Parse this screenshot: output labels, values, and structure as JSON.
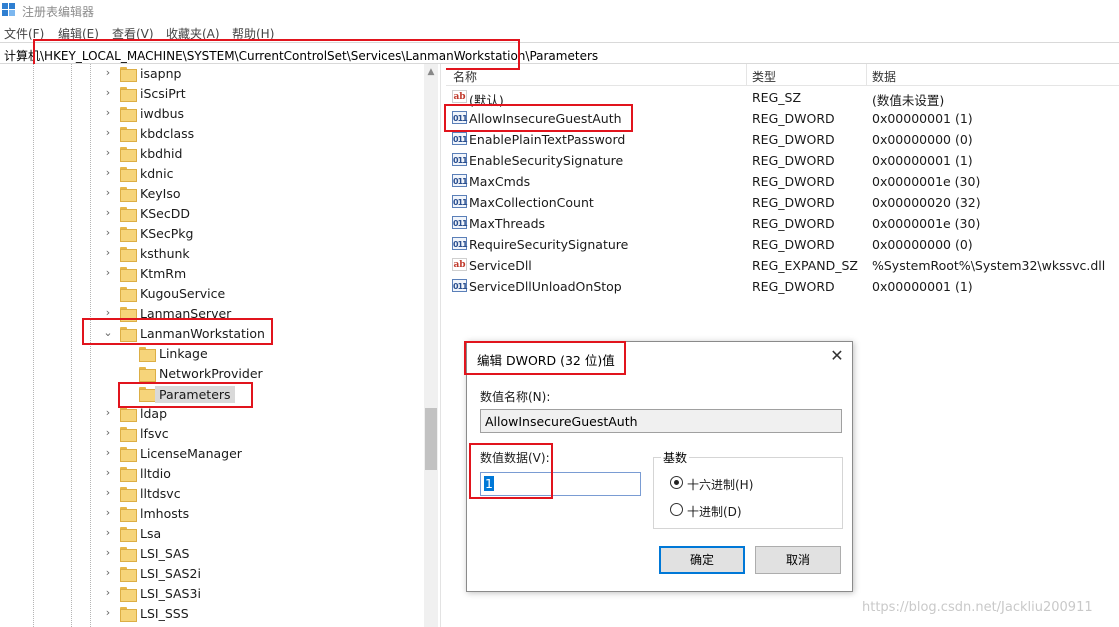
{
  "window": {
    "title": "注册表编辑器"
  },
  "menu": [
    "文件(F)",
    "编辑(E)",
    "查看(V)",
    "收藏夹(A)",
    "帮助(H)"
  ],
  "address": "计算机\\HKEY_LOCAL_MACHINE\\SYSTEM\\CurrentControlSet\\Services\\LanmanWorkstation\\Parameters",
  "tree": {
    "items": [
      {
        "label": "isapnp",
        "expand": "›"
      },
      {
        "label": "iScsiPrt",
        "expand": "›"
      },
      {
        "label": "iwdbus",
        "expand": "›"
      },
      {
        "label": "kbdclass",
        "expand": "›"
      },
      {
        "label": "kbdhid",
        "expand": "›"
      },
      {
        "label": "kdnic",
        "expand": "›"
      },
      {
        "label": "KeyIso",
        "expand": "›"
      },
      {
        "label": "KSecDD",
        "expand": "›"
      },
      {
        "label": "KSecPkg",
        "expand": "›"
      },
      {
        "label": "ksthunk",
        "expand": "›"
      },
      {
        "label": "KtmRm",
        "expand": "›"
      },
      {
        "label": "KugouService",
        "expand": ""
      },
      {
        "label": "LanmanServer",
        "expand": "›"
      },
      {
        "label": "LanmanWorkstation",
        "expand": "⌄"
      },
      {
        "label": "Linkage",
        "expand": ""
      },
      {
        "label": "NetworkProvider",
        "expand": ""
      },
      {
        "label": "Parameters",
        "expand": ""
      },
      {
        "label": "ldap",
        "expand": "›"
      },
      {
        "label": "lfsvc",
        "expand": "›"
      },
      {
        "label": "LicenseManager",
        "expand": "›"
      },
      {
        "label": "lltdio",
        "expand": "›"
      },
      {
        "label": "lltdsvc",
        "expand": "›"
      },
      {
        "label": "lmhosts",
        "expand": "›"
      },
      {
        "label": "Lsa",
        "expand": "›"
      },
      {
        "label": "LSI_SAS",
        "expand": "›"
      },
      {
        "label": "LSI_SAS2i",
        "expand": "›"
      },
      {
        "label": "LSI_SAS3i",
        "expand": "›"
      },
      {
        "label": "LSI_SSS",
        "expand": "›"
      }
    ]
  },
  "list": {
    "headers": {
      "name": "名称",
      "type": "类型",
      "data": "数据"
    },
    "rows": [
      {
        "icon": "string-value-icon",
        "glyph": "ab",
        "name": "(默认)",
        "type": "REG_SZ",
        "data": "(数值未设置)"
      },
      {
        "icon": "binary-value-icon",
        "glyph": "011",
        "name": "AllowInsecureGuestAuth",
        "type": "REG_DWORD",
        "data": "0x00000001 (1)"
      },
      {
        "icon": "binary-value-icon",
        "glyph": "011",
        "name": "EnablePlainTextPassword",
        "type": "REG_DWORD",
        "data": "0x00000000 (0)"
      },
      {
        "icon": "binary-value-icon",
        "glyph": "011",
        "name": "EnableSecuritySignature",
        "type": "REG_DWORD",
        "data": "0x00000001 (1)"
      },
      {
        "icon": "binary-value-icon",
        "glyph": "011",
        "name": "MaxCmds",
        "type": "REG_DWORD",
        "data": "0x0000001e (30)"
      },
      {
        "icon": "binary-value-icon",
        "glyph": "011",
        "name": "MaxCollectionCount",
        "type": "REG_DWORD",
        "data": "0x00000020 (32)"
      },
      {
        "icon": "binary-value-icon",
        "glyph": "011",
        "name": "MaxThreads",
        "type": "REG_DWORD",
        "data": "0x0000001e (30)"
      },
      {
        "icon": "binary-value-icon",
        "glyph": "011",
        "name": "RequireSecuritySignature",
        "type": "REG_DWORD",
        "data": "0x00000000 (0)"
      },
      {
        "icon": "string-value-icon",
        "glyph": "ab",
        "name": "ServiceDll",
        "type": "REG_EXPAND_SZ",
        "data": "%SystemRoot%\\System32\\wkssvc.dll"
      },
      {
        "icon": "binary-value-icon",
        "glyph": "011",
        "name": "ServiceDllUnloadOnStop",
        "type": "REG_DWORD",
        "data": "0x00000001 (1)"
      }
    ]
  },
  "dialog": {
    "title": "编辑 DWORD (32 位)值",
    "close_glyph": "✕",
    "name_label": "数值名称(N):",
    "name_value": "AllowInsecureGuestAuth",
    "data_label": "数值数据(V):",
    "data_value": "1",
    "base_label": "基数",
    "hex_label": "十六进制(H)",
    "dec_label": "十进制(D)",
    "base_selected": "hex",
    "ok": "确定",
    "cancel": "取消"
  },
  "watermark": "https://blog.csdn.net/Jackliu200911",
  "colors": {
    "highlight_box": "#e1141d",
    "selection": "#0078d7",
    "folder": "#f6d47a"
  }
}
